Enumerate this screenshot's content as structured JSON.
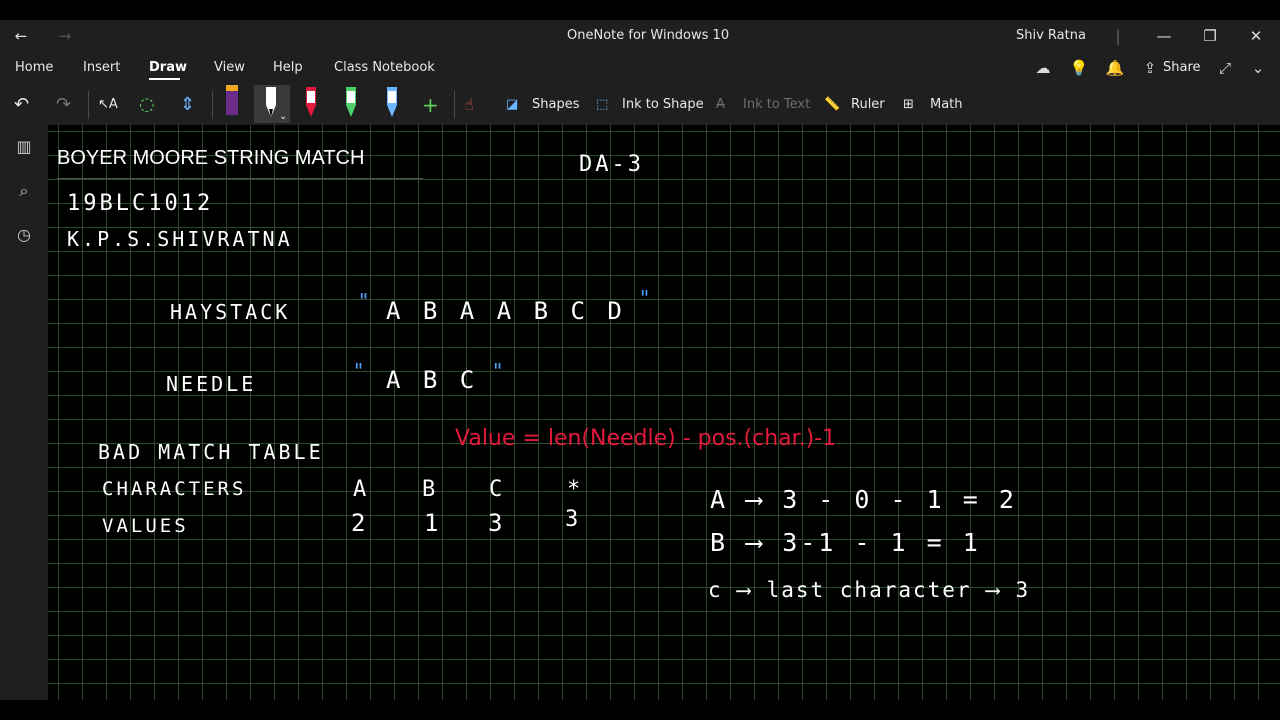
{
  "window": {
    "title": "OneNote for Windows 10",
    "user": "Shiv Ratna"
  },
  "menu": {
    "items": [
      "Home",
      "Insert",
      "Draw",
      "View",
      "Help",
      "Class Notebook"
    ],
    "active": "Draw",
    "share_label": "Share"
  },
  "toolbar": {
    "shapes": "Shapes",
    "ink_to_shape": "Ink to Shape",
    "ink_to_text": "Ink to Text",
    "ruler": "Ruler",
    "math": "Math"
  },
  "page": {
    "title": "BOYER MOORE STRING MATCH",
    "da": "DA-3",
    "reg_no": "19BLC1012",
    "name": "K.P.S.SHIVRATNA",
    "haystack_label": "HAYSTACK",
    "haystack_value": "A B A A B C D",
    "needle_label": "NEEDLE",
    "needle_value": "A B C",
    "table_title": "BAD MATCH TABLE",
    "formula": "Value = len(Needle) - pos.(char.)-1",
    "row_characters_label": "CHARACTERS",
    "row_values_label": "VALUES",
    "characters": [
      "A",
      "B",
      "C",
      "*"
    ],
    "values": [
      "2",
      "1",
      "3",
      "3"
    ],
    "calc": [
      "A ⟶ 3 - 0 - 1 = 2",
      "B ⟶ 3-1 - 1 = 1",
      "c ⟶ last character ⟶ 3"
    ]
  },
  "colors": {
    "ink_red": "#e21a3d",
    "ink_blue": "#4aa3ff",
    "grid": "#2a4a2a"
  }
}
